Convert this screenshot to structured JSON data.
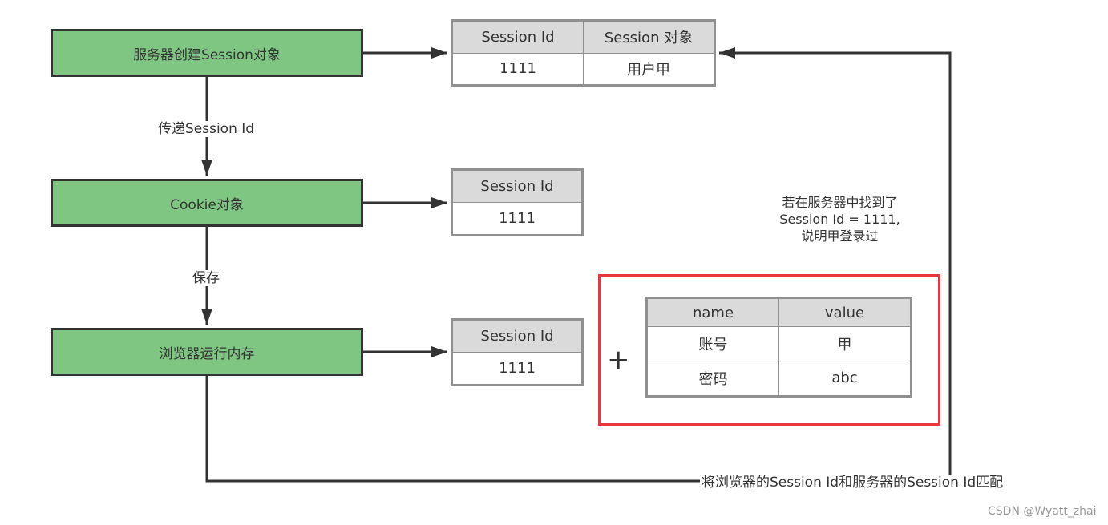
{
  "nodes": {
    "server_create": "服务器创建Session对象",
    "cookie_object": "Cookie对象",
    "browser_memory": "浏览器运行内存"
  },
  "edges": {
    "pass_session_id": "传递Session Id",
    "save": "保存",
    "match": "将浏览器的Session Id和服务器的Session Id匹配"
  },
  "tables": {
    "server_table": {
      "headers": [
        "Session Id",
        "Session 对象"
      ],
      "rows": [
        [
          "1111",
          "用户甲"
        ]
      ]
    },
    "cookie_table": {
      "headers": [
        "Session Id"
      ],
      "rows": [
        [
          "1111"
        ]
      ]
    },
    "browser_table": {
      "headers": [
        "Session Id"
      ],
      "rows": [
        [
          "1111"
        ]
      ]
    },
    "credentials_table": {
      "headers": [
        "name",
        "value"
      ],
      "rows": [
        [
          "账号",
          "甲"
        ],
        [
          "密码",
          "abc"
        ]
      ]
    }
  },
  "plus_sign": "+",
  "note": {
    "line1": "若在服务器中找到了",
    "line2": "Session Id = 1111,",
    "line3": "说明甲登录过"
  },
  "colors": {
    "node_fill": "#7fc683",
    "highlight_border": "#e8383b",
    "table_header": "#dadada"
  },
  "watermark": "CSDN @Wyatt_zhai"
}
